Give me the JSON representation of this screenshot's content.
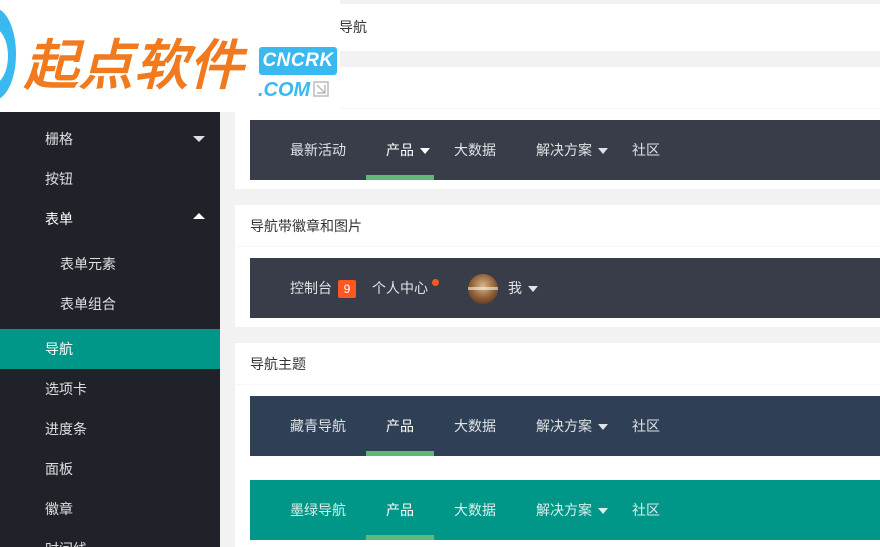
{
  "sidebar": {
    "items": [
      {
        "label": "栅格"
      },
      {
        "label": "按钮"
      },
      {
        "label": "表单"
      },
      {
        "label": "表单元素"
      },
      {
        "label": "表单组合"
      },
      {
        "label": "导航"
      },
      {
        "label": "选项卡"
      },
      {
        "label": "进度条"
      },
      {
        "label": "面板"
      },
      {
        "label": "徽章"
      },
      {
        "label": "时间线"
      }
    ]
  },
  "logo": {
    "text": "起点软件",
    "badge": "CNCRK",
    "domain": ".COM"
  },
  "breadcrumb": {
    "label": "导航"
  },
  "nav_default": {
    "items": [
      "最新活动",
      "产品",
      "大数据",
      "解决方案",
      "社区"
    ]
  },
  "nav_badge_section": {
    "title": "导航带徽章和图片",
    "console_label": "控制台",
    "console_badge": "9",
    "profile_label": "个人中心",
    "me_label": "我"
  },
  "nav_theme_section": {
    "title": "导航主题",
    "cyan": {
      "items": [
        "藏青导航",
        "产品",
        "大数据",
        "解决方案",
        "社区"
      ]
    },
    "green": {
      "items": [
        "墨绿导航",
        "产品",
        "大数据",
        "解决方案",
        "社区"
      ]
    }
  },
  "colors": {
    "sidebar_bg": "#20222a",
    "active": "#009688",
    "nav_dark": "#393d49",
    "nav_cyan": "#2f4056",
    "nav_green": "#009688",
    "underline": "#5fb878",
    "badge": "#ff5722",
    "logo_orange": "#f07a1d",
    "logo_blue": "#3ab8f0"
  }
}
